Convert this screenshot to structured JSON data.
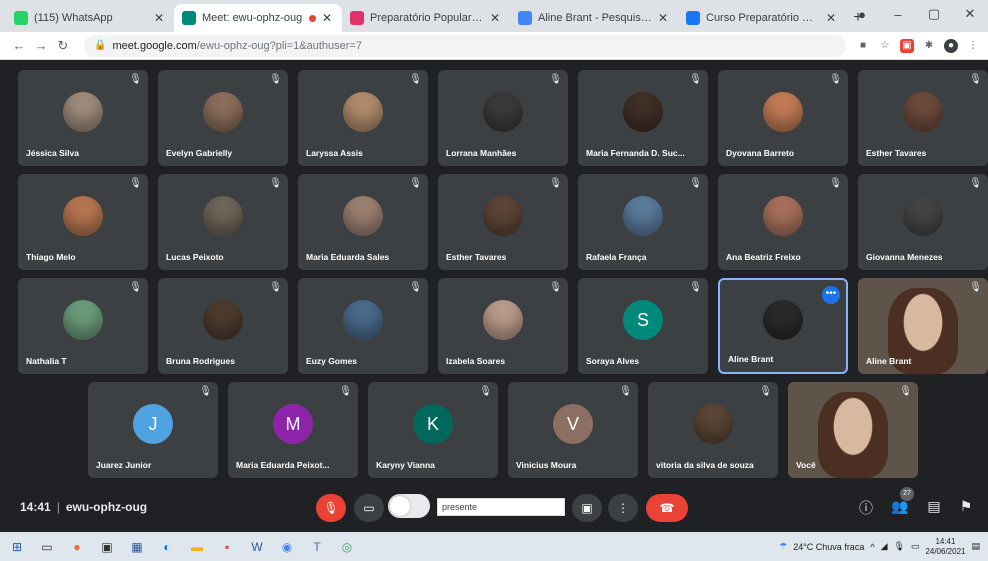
{
  "browser": {
    "tabs": [
      {
        "label": "(115) WhatsApp",
        "color": "#25d366",
        "active": false,
        "recording": false
      },
      {
        "label": "Meet: ewu-ophz-oug",
        "color": "#00897b",
        "active": true,
        "recording": true
      },
      {
        "label": "Preparatório Popular Goitacá",
        "color": "#e1306c",
        "active": false,
        "recording": false
      },
      {
        "label": "Aline Brant - Pesquisa Google",
        "color": "#4285f4",
        "active": false,
        "recording": false
      },
      {
        "label": "Curso Preparatório Popular",
        "color": "#1877f2",
        "active": false,
        "recording": false
      }
    ],
    "new_tab": "+",
    "url_host": "meet.google.com",
    "url_path": "/ewu-ophz-oug?pli=1&authuser=7"
  },
  "participants": [
    {
      "name": "Jéssica Silva",
      "avatar": "photo",
      "color": "#9c8a7a"
    },
    {
      "name": "Evelyn Gabrielly",
      "avatar": "photo",
      "color": "#8a6d5a"
    },
    {
      "name": "Laryssa Assis",
      "avatar": "photo",
      "color": "#b08b6a"
    },
    {
      "name": "Lorrana Manhães",
      "avatar": "photo",
      "color": "#3a3a3a"
    },
    {
      "name": "Maria Fernanda D. Suc...",
      "avatar": "photo",
      "color": "#3f2f26"
    },
    {
      "name": "Dyovana Barreto",
      "avatar": "photo",
      "color": "#c27a54"
    },
    {
      "name": "Esther Tavares",
      "avatar": "photo",
      "color": "#6b4a3a"
    },
    {
      "name": "Thiago Melo",
      "avatar": "photo",
      "color": "#b5754f"
    },
    {
      "name": "Lucas Peixoto",
      "avatar": "photo",
      "color": "#6e6458"
    },
    {
      "name": "Maria Eduarda Sales",
      "avatar": "photo",
      "color": "#9a7e70"
    },
    {
      "name": "Esther Tavares",
      "avatar": "photo",
      "color": "#5c4436"
    },
    {
      "name": "Rafaela França",
      "avatar": "photo",
      "color": "#5a7a9a"
    },
    {
      "name": "Ana Beatriz Freixo",
      "avatar": "photo",
      "color": "#a6705a"
    },
    {
      "name": "Giovanna Menezes",
      "avatar": "photo",
      "color": "#444444"
    },
    {
      "name": "Nathalia T",
      "avatar": "photo",
      "color": "#6a9a7a"
    },
    {
      "name": "Bruna Rodrigues",
      "avatar": "photo",
      "color": "#4d3a2e"
    },
    {
      "name": "Euzy Gomes",
      "avatar": "photo",
      "color": "#4a6a8a"
    },
    {
      "name": "Izabela Soares",
      "avatar": "photo",
      "color": "#b89a8a"
    },
    {
      "name": "Soraya Alves",
      "avatar": "S",
      "color": "#00897b"
    },
    {
      "name": "Aline Brant",
      "avatar": "photo",
      "color": "#2a2a2a",
      "highlight": true
    },
    {
      "name": "Aline Brant",
      "avatar": "video"
    },
    {
      "name": "Juarez Junior",
      "avatar": "J",
      "color": "#4fa3e0"
    },
    {
      "name": "Maria Eduarda Peixot...",
      "avatar": "M",
      "color": "#8e24aa"
    },
    {
      "name": "Karyny Vianna",
      "avatar": "K",
      "color": "#00695c"
    },
    {
      "name": "Vinicius Moura",
      "avatar": "V",
      "color": "#8d6e63"
    },
    {
      "name": "vitoria da silva de souza",
      "avatar": "photo",
      "color": "#5a4536"
    },
    {
      "name": "Você",
      "avatar": "video"
    }
  ],
  "meeting": {
    "time": "14:41",
    "code": "ewu-ophz-oug",
    "chat_value": "presente",
    "participant_count": "27"
  },
  "taskbar": {
    "weather": "24°C  Chuva fraca",
    "time": "14:41",
    "date": "24/06/2021"
  }
}
